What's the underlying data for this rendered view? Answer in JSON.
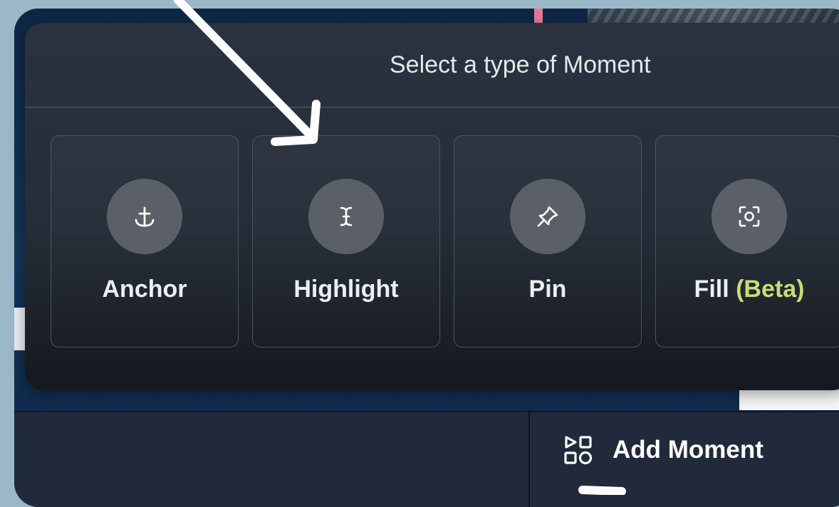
{
  "panel": {
    "title": "Select a type of Moment"
  },
  "moment_types": [
    {
      "label": "Anchor",
      "icon": "anchor-icon"
    },
    {
      "label": "Highlight",
      "icon": "text-cursor-icon"
    },
    {
      "label": "Pin",
      "icon": "pin-icon"
    },
    {
      "label": "Fill",
      "suffix": "(Beta)",
      "icon": "focus-icon"
    }
  ],
  "bottom_bar": {
    "add_moment_label": "Add Moment",
    "add_moment_icon": "shapes-icon"
  },
  "colors": {
    "accent_beta": "#c8dc73",
    "panel_bg": "#262d38",
    "page_bg": "#9bb8c9"
  }
}
